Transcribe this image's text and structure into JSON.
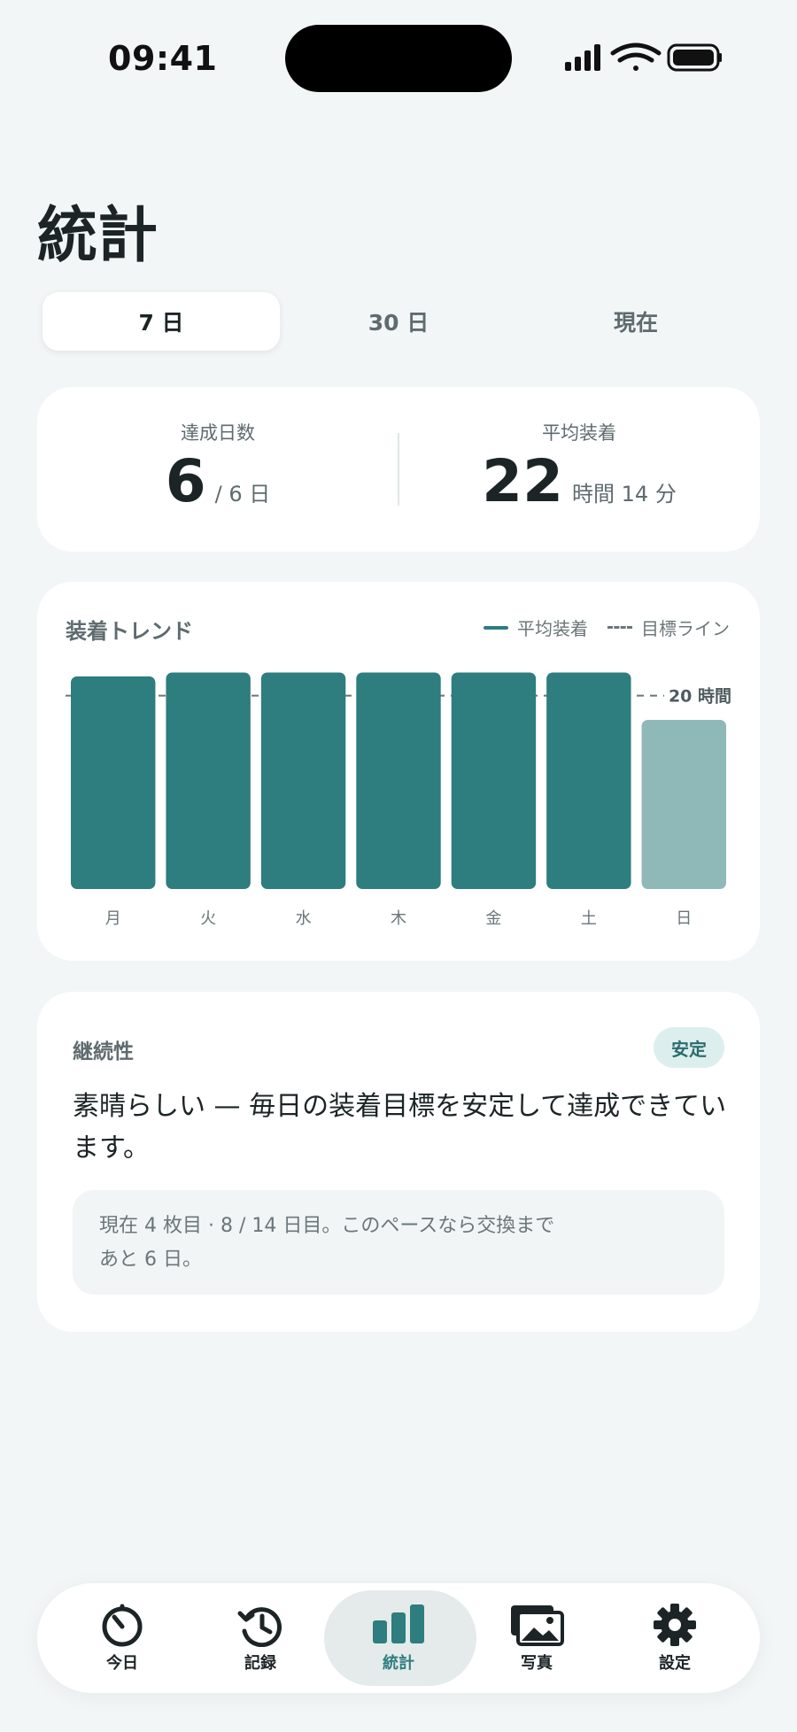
{
  "status_bar": {
    "time": "09:41"
  },
  "page": {
    "title": "統計"
  },
  "segments": [
    {
      "label": "7 日",
      "active": true
    },
    {
      "label": "30 日",
      "active": false
    },
    {
      "label": "現在",
      "active": false
    }
  ],
  "summary": {
    "achieved": {
      "label": "達成日数",
      "value": "6",
      "unit": "/ 6 日"
    },
    "average": {
      "label": "平均装着",
      "value": "22",
      "unit": "時間 14 分"
    }
  },
  "chart": {
    "title": "装着トレンド",
    "legend_avg": "平均装着",
    "legend_goal": "目標ライン",
    "goal_label": "20 時間"
  },
  "chart_data": {
    "type": "bar",
    "title": "装着トレンド",
    "categories": [
      "月",
      "火",
      "水",
      "木",
      "金",
      "土",
      "日"
    ],
    "series": [
      {
        "name": "平均装着",
        "values": [
          22.0,
          22.4,
          22.4,
          22.4,
          22.4,
          22.4,
          17.5
        ]
      }
    ],
    "goal_line": 20,
    "goal_label": "20 時間",
    "ylim": [
      0,
      24
    ],
    "colors": {
      "bar": "#2e7d7f",
      "bar_current": "#8fb8b9",
      "goal": "#6b7679"
    }
  },
  "continuity": {
    "title": "継続性",
    "badge": "安定",
    "message": "素晴らしい — 毎日の装着目標を安定して達成できています。",
    "note_line1": "現在 4 枚目 · 8 / 14 日目。このペースなら交換まで",
    "note_line2": "あと 6 日。"
  },
  "tabbar": {
    "items": [
      {
        "label": "今日",
        "icon": "timer-icon"
      },
      {
        "label": "記録",
        "icon": "history-icon"
      },
      {
        "label": "統計",
        "icon": "stats-icon",
        "active": true
      },
      {
        "label": "写真",
        "icon": "photos-icon"
      },
      {
        "label": "設定",
        "icon": "gear-icon"
      }
    ]
  },
  "colors": {
    "accent": "#2e7d7f",
    "background": "#f2f6f7"
  }
}
